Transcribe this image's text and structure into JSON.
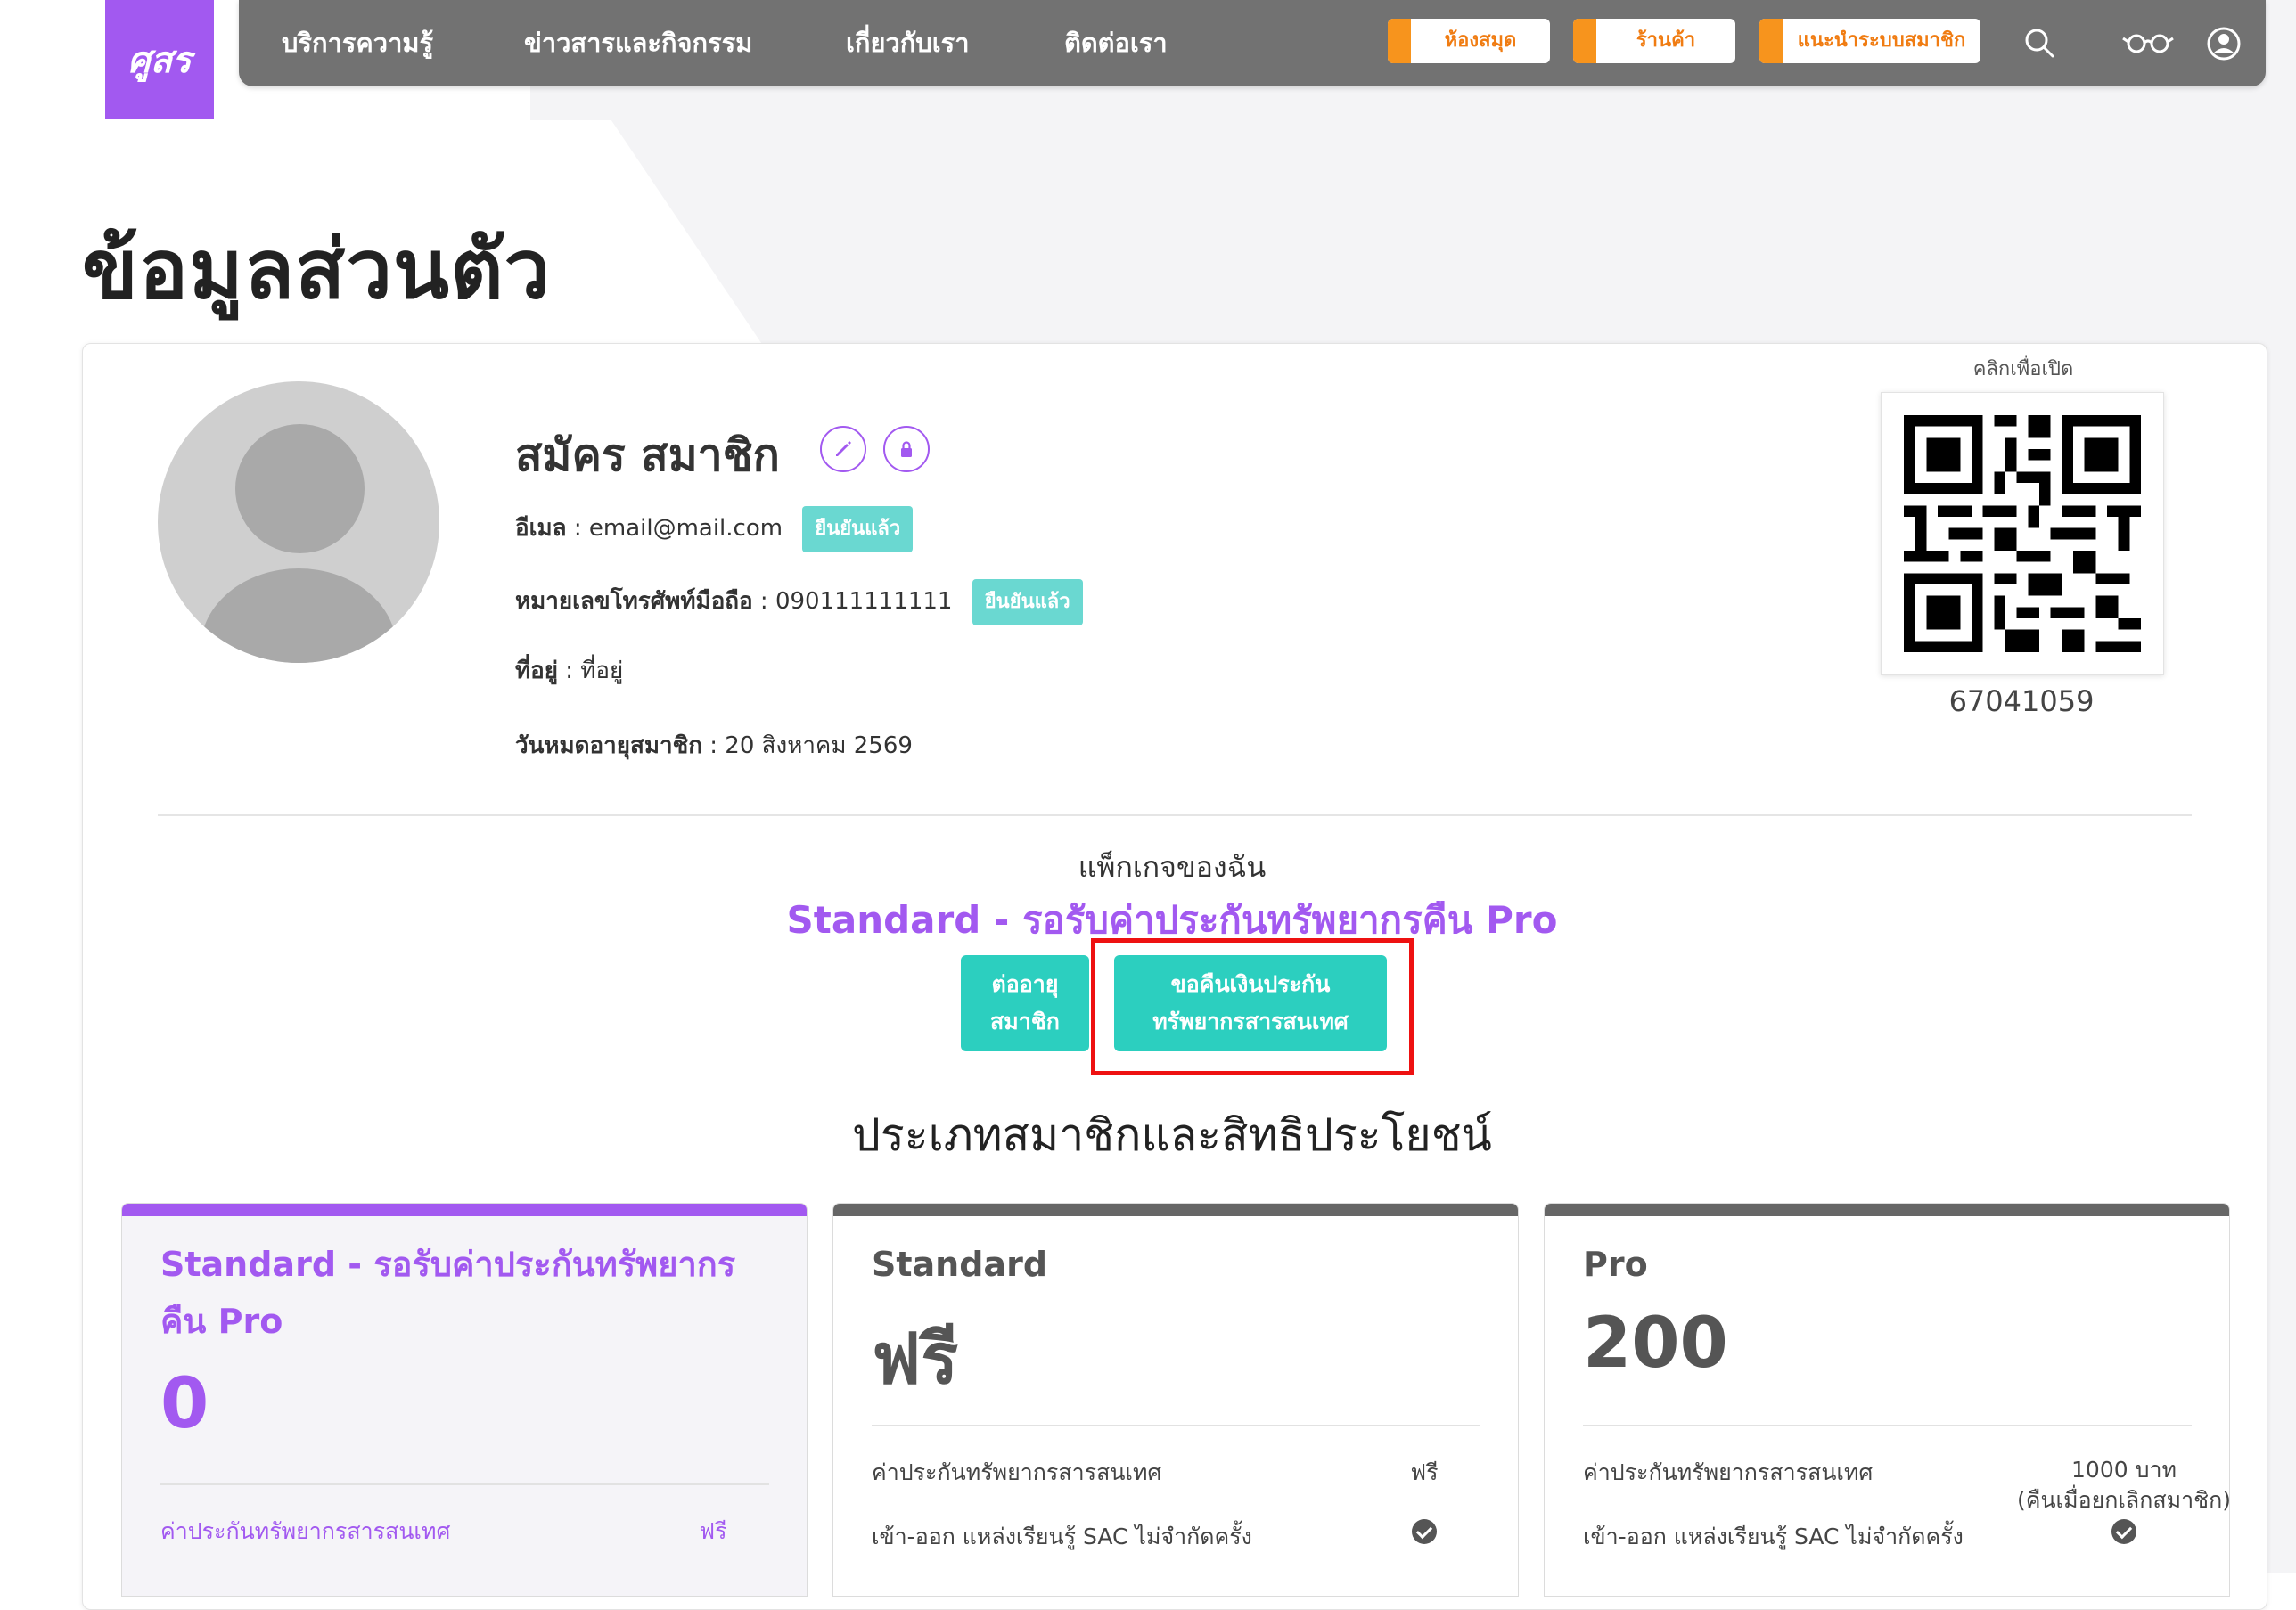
{
  "nav": {
    "logo_text": "ศูสร",
    "links": [
      "บริการความรู้",
      "ข่าวสารและกิจกรรม",
      "เกี่ยวกับเรา",
      "ติดต่อเรา"
    ],
    "buttons": [
      "ห้องสมุด",
      "ร้านค้า",
      "แนะนำระบบสมาชิก"
    ],
    "icons": [
      "search-icon",
      "glasses-icon",
      "user-icon"
    ]
  },
  "page": {
    "title": "ข้อมูลส่วนตัว"
  },
  "profile": {
    "name": "สมัคร สมาชิก",
    "email_label": "อีเมล",
    "email": "email@mail.com",
    "email_status": "ยืนยันแล้ว",
    "phone_label": "หมายเลขโทรศัพท์มือถือ",
    "phone": "090111111111",
    "phone_status": "ยืนยันแล้ว",
    "address_label": "ที่อยู่",
    "address": "ที่อยู่",
    "expiry_label": "วันหมดอายุสมาชิก",
    "expiry": "20 สิงหาคม 2569",
    "qr_hint": "คลิกเพื่อเปิด",
    "member_id": "67041059"
  },
  "package": {
    "caption": "แพ็กเกจของฉัน",
    "name": "Standard - รอรับค่าประกันทรัพยากรคืน Pro",
    "renew_line1": "ต่ออายุ",
    "renew_line2": "สมาชิก",
    "refund_line1": "ขอคืนเงินประกัน",
    "refund_line2": "ทรัพยากรสารสนเทศ"
  },
  "plans_section": {
    "title": "ประเภทสมาชิกและสิทธิประโยชน์",
    "plans": [
      {
        "name": "Standard - รอรับค่าประกันทรัพยากรคืน Pro",
        "price": "0",
        "features": [
          {
            "label": "ค่าประกันทรัพยากรสารสนเทศ",
            "value": "ฟรี"
          }
        ]
      },
      {
        "name": "Standard",
        "price": "ฟรี",
        "features": [
          {
            "label": "ค่าประกันทรัพยากรสารสนเทศ",
            "value": "ฟรี"
          },
          {
            "label": "เข้า-ออก แหล่งเรียนรู้ SAC ไม่จำกัดครั้ง",
            "value": "check-icon"
          }
        ]
      },
      {
        "name": "Pro",
        "price": "200",
        "features": [
          {
            "label": "ค่าประกันทรัพยากรสารสนเทศ",
            "value_line1": "1000 บาท",
            "value_line2": "(คืนเมื่อยกเลิกสมาชิก)"
          },
          {
            "label": "เข้า-ออก แหล่งเรียนรู้ SAC ไม่จำกัดครั้ง",
            "value": "check-icon"
          }
        ]
      }
    ]
  }
}
